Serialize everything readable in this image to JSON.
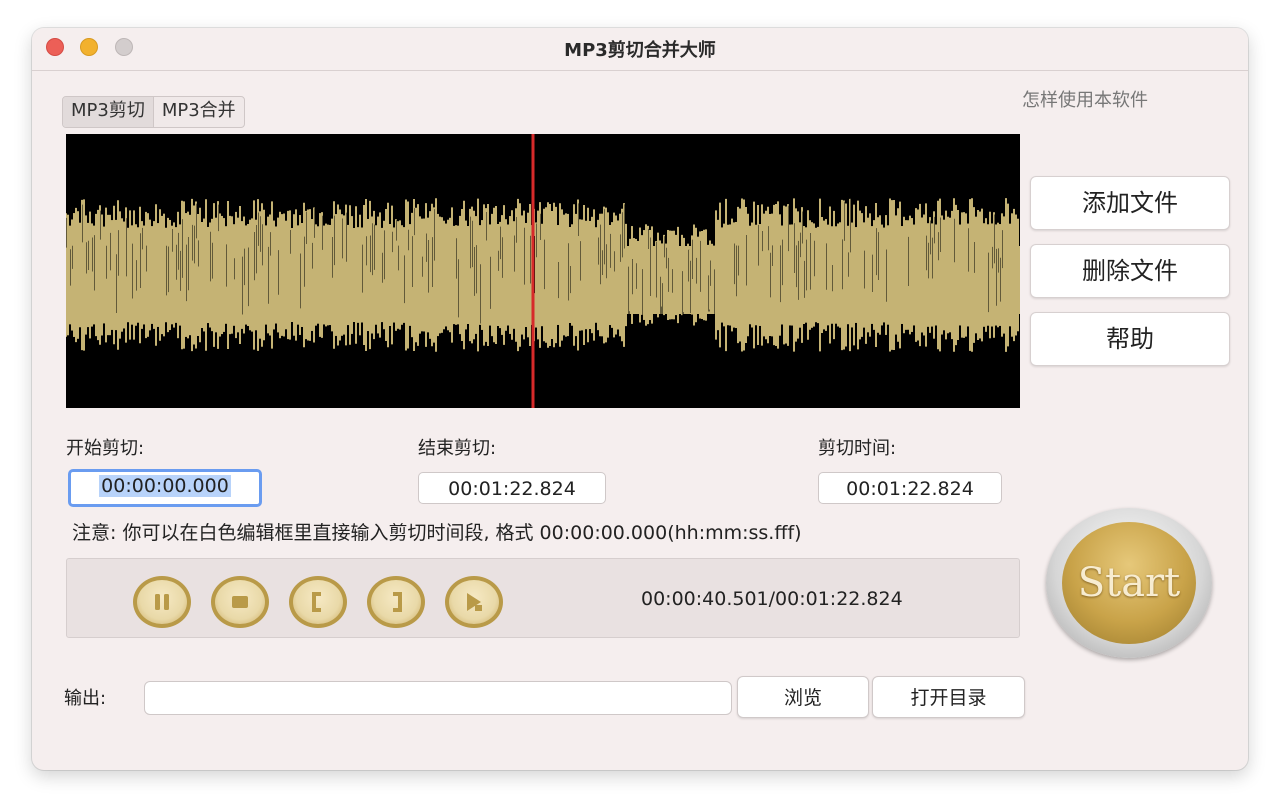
{
  "window": {
    "title": "MP3剪切合并大师"
  },
  "tabs": [
    {
      "label": "MP3剪切",
      "active": true
    },
    {
      "label": "MP3合并",
      "active": false
    }
  ],
  "help_link": "怎样使用本软件",
  "side_buttons": {
    "add": "添加文件",
    "delete": "删除文件",
    "help": "帮助"
  },
  "cut": {
    "start_label": "开始剪切:",
    "end_label": "结束剪切:",
    "duration_label": "剪切时间:",
    "start_value": "00:00:00.000",
    "end_value": "00:01:22.824",
    "duration_value": "00:01:22.824"
  },
  "notice": "注意: 你可以在白色编辑框里直接输入剪切时间段, 格式 00:00:00.000(hh:mm:ss.fff)",
  "player": {
    "time_display": "00:00:40.501/00:01:22.824",
    "playhead_fraction": 0.489
  },
  "start_button": "Start",
  "output": {
    "label": "输出:",
    "value": "",
    "browse": "浏览",
    "open_dir": "打开目录"
  },
  "colors": {
    "waveform": "#c5b374",
    "playhead": "#d62a2a",
    "gold": "#c9a349"
  }
}
